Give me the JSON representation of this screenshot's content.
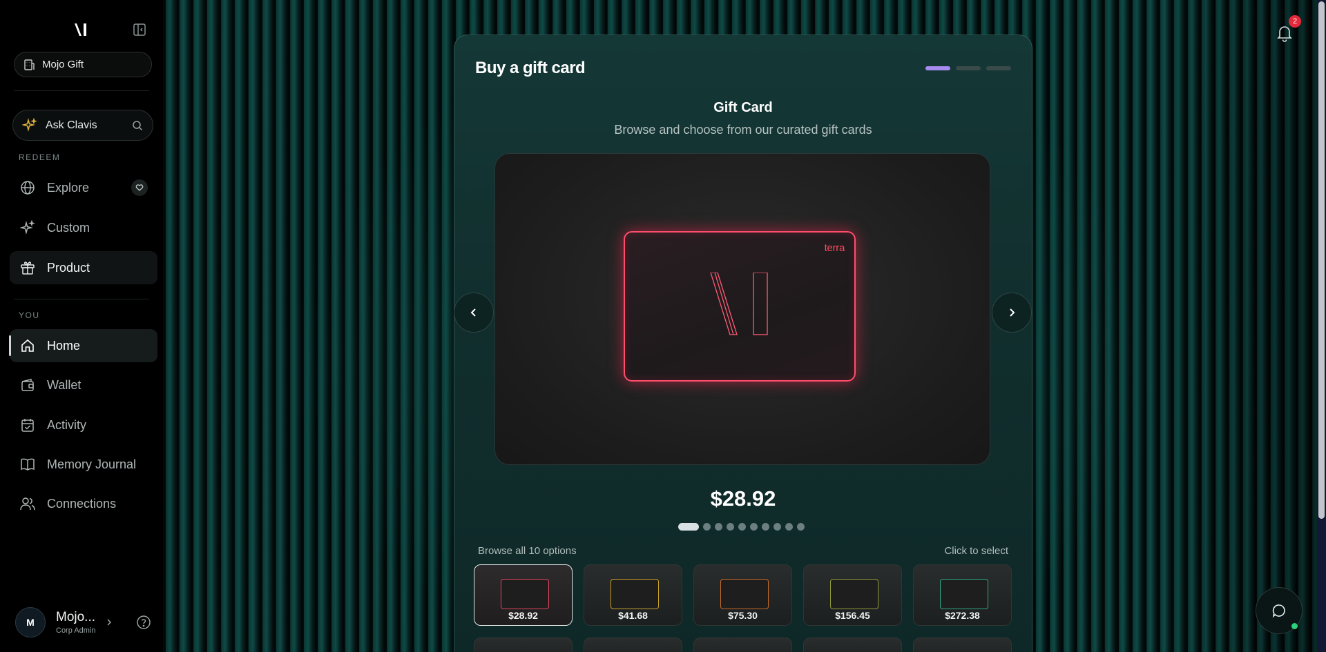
{
  "sidebar": {
    "org_name": "Mojo Gift",
    "ask_label": "Ask Clavis",
    "section_redeem": "REDEEM",
    "section_you": "YOU",
    "redeem_items": [
      {
        "label": "Explore",
        "icon": "globe-icon"
      },
      {
        "label": "Custom",
        "icon": "sparkles-icon"
      },
      {
        "label": "Product",
        "icon": "gift-icon"
      }
    ],
    "you_items": [
      {
        "label": "Home",
        "icon": "home-icon"
      },
      {
        "label": "Wallet",
        "icon": "wallet-icon"
      },
      {
        "label": "Activity",
        "icon": "calendar-check-icon"
      },
      {
        "label": "Memory Journal",
        "icon": "book-icon"
      },
      {
        "label": "Connections",
        "icon": "users-icon"
      }
    ],
    "active_item": "Home",
    "user": {
      "initial": "M",
      "name": "Mojo...",
      "role": "Corp Admin"
    }
  },
  "header": {
    "notifications_count": "2"
  },
  "main": {
    "title": "Buy a gift card",
    "step_current": 1,
    "step_total": 3,
    "subtitle": "Gift Card",
    "description": "Browse and choose from our curated gift cards",
    "featured_card": {
      "brand": "terra",
      "price": "$28.92",
      "accent_color": "#ff4e6c"
    },
    "carousel_position": 1,
    "carousel_total": 10,
    "browse_label": "Browse all 10 options",
    "select_hint": "Click to select",
    "options": [
      {
        "price": "$28.92",
        "color": "#e0455e",
        "selected": true
      },
      {
        "price": "$41.68",
        "color": "#c9a12a",
        "selected": false
      },
      {
        "price": "$75.30",
        "color": "#c96a2a",
        "selected": false
      },
      {
        "price": "$156.45",
        "color": "#8f9a3a",
        "selected": false
      },
      {
        "price": "$272.38",
        "color": "#2faa80",
        "selected": false
      }
    ]
  },
  "colors": {
    "accent": "#a88bf0",
    "notification_badge": "#e5283a",
    "online": "#2fd07a"
  }
}
